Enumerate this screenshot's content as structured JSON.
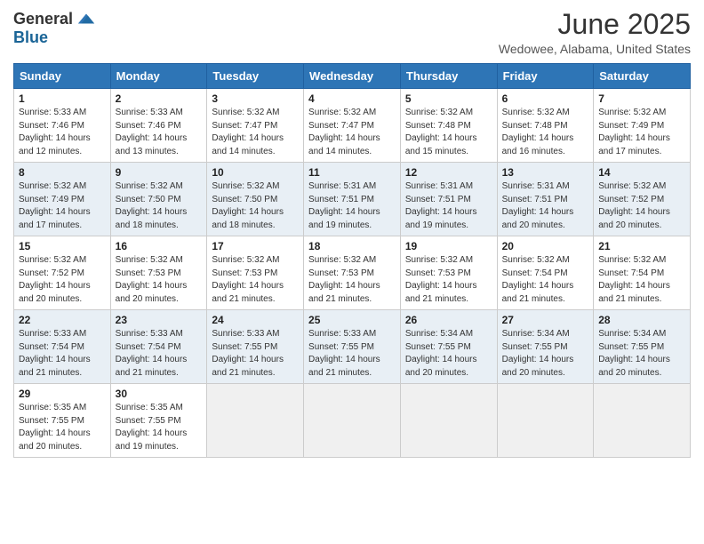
{
  "logo": {
    "general": "General",
    "blue": "Blue"
  },
  "title": "June 2025",
  "subtitle": "Wedowee, Alabama, United States",
  "weekdays": [
    "Sunday",
    "Monday",
    "Tuesday",
    "Wednesday",
    "Thursday",
    "Friday",
    "Saturday"
  ],
  "weeks": [
    [
      {
        "day": "1",
        "sunrise": "5:33 AM",
        "sunset": "7:46 PM",
        "daylight": "14 hours and 12 minutes."
      },
      {
        "day": "2",
        "sunrise": "5:33 AM",
        "sunset": "7:46 PM",
        "daylight": "14 hours and 13 minutes."
      },
      {
        "day": "3",
        "sunrise": "5:32 AM",
        "sunset": "7:47 PM",
        "daylight": "14 hours and 14 minutes."
      },
      {
        "day": "4",
        "sunrise": "5:32 AM",
        "sunset": "7:47 PM",
        "daylight": "14 hours and 14 minutes."
      },
      {
        "day": "5",
        "sunrise": "5:32 AM",
        "sunset": "7:48 PM",
        "daylight": "14 hours and 15 minutes."
      },
      {
        "day": "6",
        "sunrise": "5:32 AM",
        "sunset": "7:48 PM",
        "daylight": "14 hours and 16 minutes."
      },
      {
        "day": "7",
        "sunrise": "5:32 AM",
        "sunset": "7:49 PM",
        "daylight": "14 hours and 17 minutes."
      }
    ],
    [
      {
        "day": "8",
        "sunrise": "5:32 AM",
        "sunset": "7:49 PM",
        "daylight": "14 hours and 17 minutes."
      },
      {
        "day": "9",
        "sunrise": "5:32 AM",
        "sunset": "7:50 PM",
        "daylight": "14 hours and 18 minutes."
      },
      {
        "day": "10",
        "sunrise": "5:32 AM",
        "sunset": "7:50 PM",
        "daylight": "14 hours and 18 minutes."
      },
      {
        "day": "11",
        "sunrise": "5:31 AM",
        "sunset": "7:51 PM",
        "daylight": "14 hours and 19 minutes."
      },
      {
        "day": "12",
        "sunrise": "5:31 AM",
        "sunset": "7:51 PM",
        "daylight": "14 hours and 19 minutes."
      },
      {
        "day": "13",
        "sunrise": "5:31 AM",
        "sunset": "7:51 PM",
        "daylight": "14 hours and 20 minutes."
      },
      {
        "day": "14",
        "sunrise": "5:32 AM",
        "sunset": "7:52 PM",
        "daylight": "14 hours and 20 minutes."
      }
    ],
    [
      {
        "day": "15",
        "sunrise": "5:32 AM",
        "sunset": "7:52 PM",
        "daylight": "14 hours and 20 minutes."
      },
      {
        "day": "16",
        "sunrise": "5:32 AM",
        "sunset": "7:53 PM",
        "daylight": "14 hours and 20 minutes."
      },
      {
        "day": "17",
        "sunrise": "5:32 AM",
        "sunset": "7:53 PM",
        "daylight": "14 hours and 21 minutes."
      },
      {
        "day": "18",
        "sunrise": "5:32 AM",
        "sunset": "7:53 PM",
        "daylight": "14 hours and 21 minutes."
      },
      {
        "day": "19",
        "sunrise": "5:32 AM",
        "sunset": "7:53 PM",
        "daylight": "14 hours and 21 minutes."
      },
      {
        "day": "20",
        "sunrise": "5:32 AM",
        "sunset": "7:54 PM",
        "daylight": "14 hours and 21 minutes."
      },
      {
        "day": "21",
        "sunrise": "5:32 AM",
        "sunset": "7:54 PM",
        "daylight": "14 hours and 21 minutes."
      }
    ],
    [
      {
        "day": "22",
        "sunrise": "5:33 AM",
        "sunset": "7:54 PM",
        "daylight": "14 hours and 21 minutes."
      },
      {
        "day": "23",
        "sunrise": "5:33 AM",
        "sunset": "7:54 PM",
        "daylight": "14 hours and 21 minutes."
      },
      {
        "day": "24",
        "sunrise": "5:33 AM",
        "sunset": "7:55 PM",
        "daylight": "14 hours and 21 minutes."
      },
      {
        "day": "25",
        "sunrise": "5:33 AM",
        "sunset": "7:55 PM",
        "daylight": "14 hours and 21 minutes."
      },
      {
        "day": "26",
        "sunrise": "5:34 AM",
        "sunset": "7:55 PM",
        "daylight": "14 hours and 20 minutes."
      },
      {
        "day": "27",
        "sunrise": "5:34 AM",
        "sunset": "7:55 PM",
        "daylight": "14 hours and 20 minutes."
      },
      {
        "day": "28",
        "sunrise": "5:34 AM",
        "sunset": "7:55 PM",
        "daylight": "14 hours and 20 minutes."
      }
    ],
    [
      {
        "day": "29",
        "sunrise": "5:35 AM",
        "sunset": "7:55 PM",
        "daylight": "14 hours and 20 minutes."
      },
      {
        "day": "30",
        "sunrise": "5:35 AM",
        "sunset": "7:55 PM",
        "daylight": "14 hours and 19 minutes."
      },
      null,
      null,
      null,
      null,
      null
    ]
  ],
  "labels": {
    "sunrise": "Sunrise:",
    "sunset": "Sunset:",
    "daylight": "Daylight: 14 hours"
  }
}
